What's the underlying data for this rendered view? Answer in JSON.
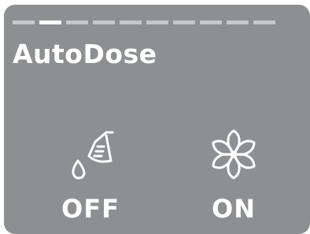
{
  "header": {
    "title": "AutoDose",
    "pager_total": 10,
    "pager_active": 2
  },
  "options": [
    {
      "label": "OFF",
      "icon": "measuring-cup-drop-icon",
      "selected": false
    },
    {
      "label": "ON",
      "icon": "flower-icon",
      "selected": true
    }
  ],
  "colors": {
    "background": "#8e8f91",
    "foreground": "#ffffff",
    "pager_inactive": "#c7c8ca"
  }
}
